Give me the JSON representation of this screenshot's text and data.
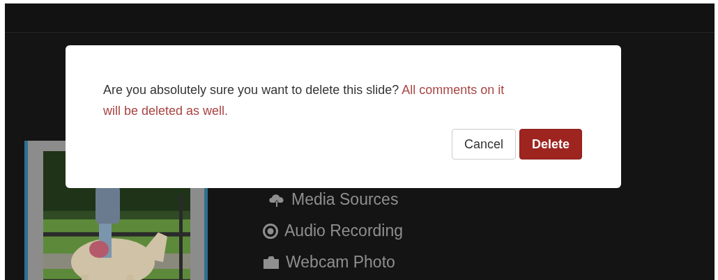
{
  "menu": [
    {
      "label": "Media Sources",
      "kind": "cloud"
    },
    {
      "label": "Audio Recording",
      "kind": "record"
    },
    {
      "label": "Webcam Photo",
      "kind": "camera"
    }
  ],
  "dialog": {
    "message": "Are you absolutely sure you want to delete this slide? ",
    "warning": "All comments on it will be deleted as well.",
    "buttons": [
      {
        "label": "Cancel",
        "kind": "secondary"
      },
      {
        "label": "Delete",
        "kind": "danger"
      }
    ]
  }
}
